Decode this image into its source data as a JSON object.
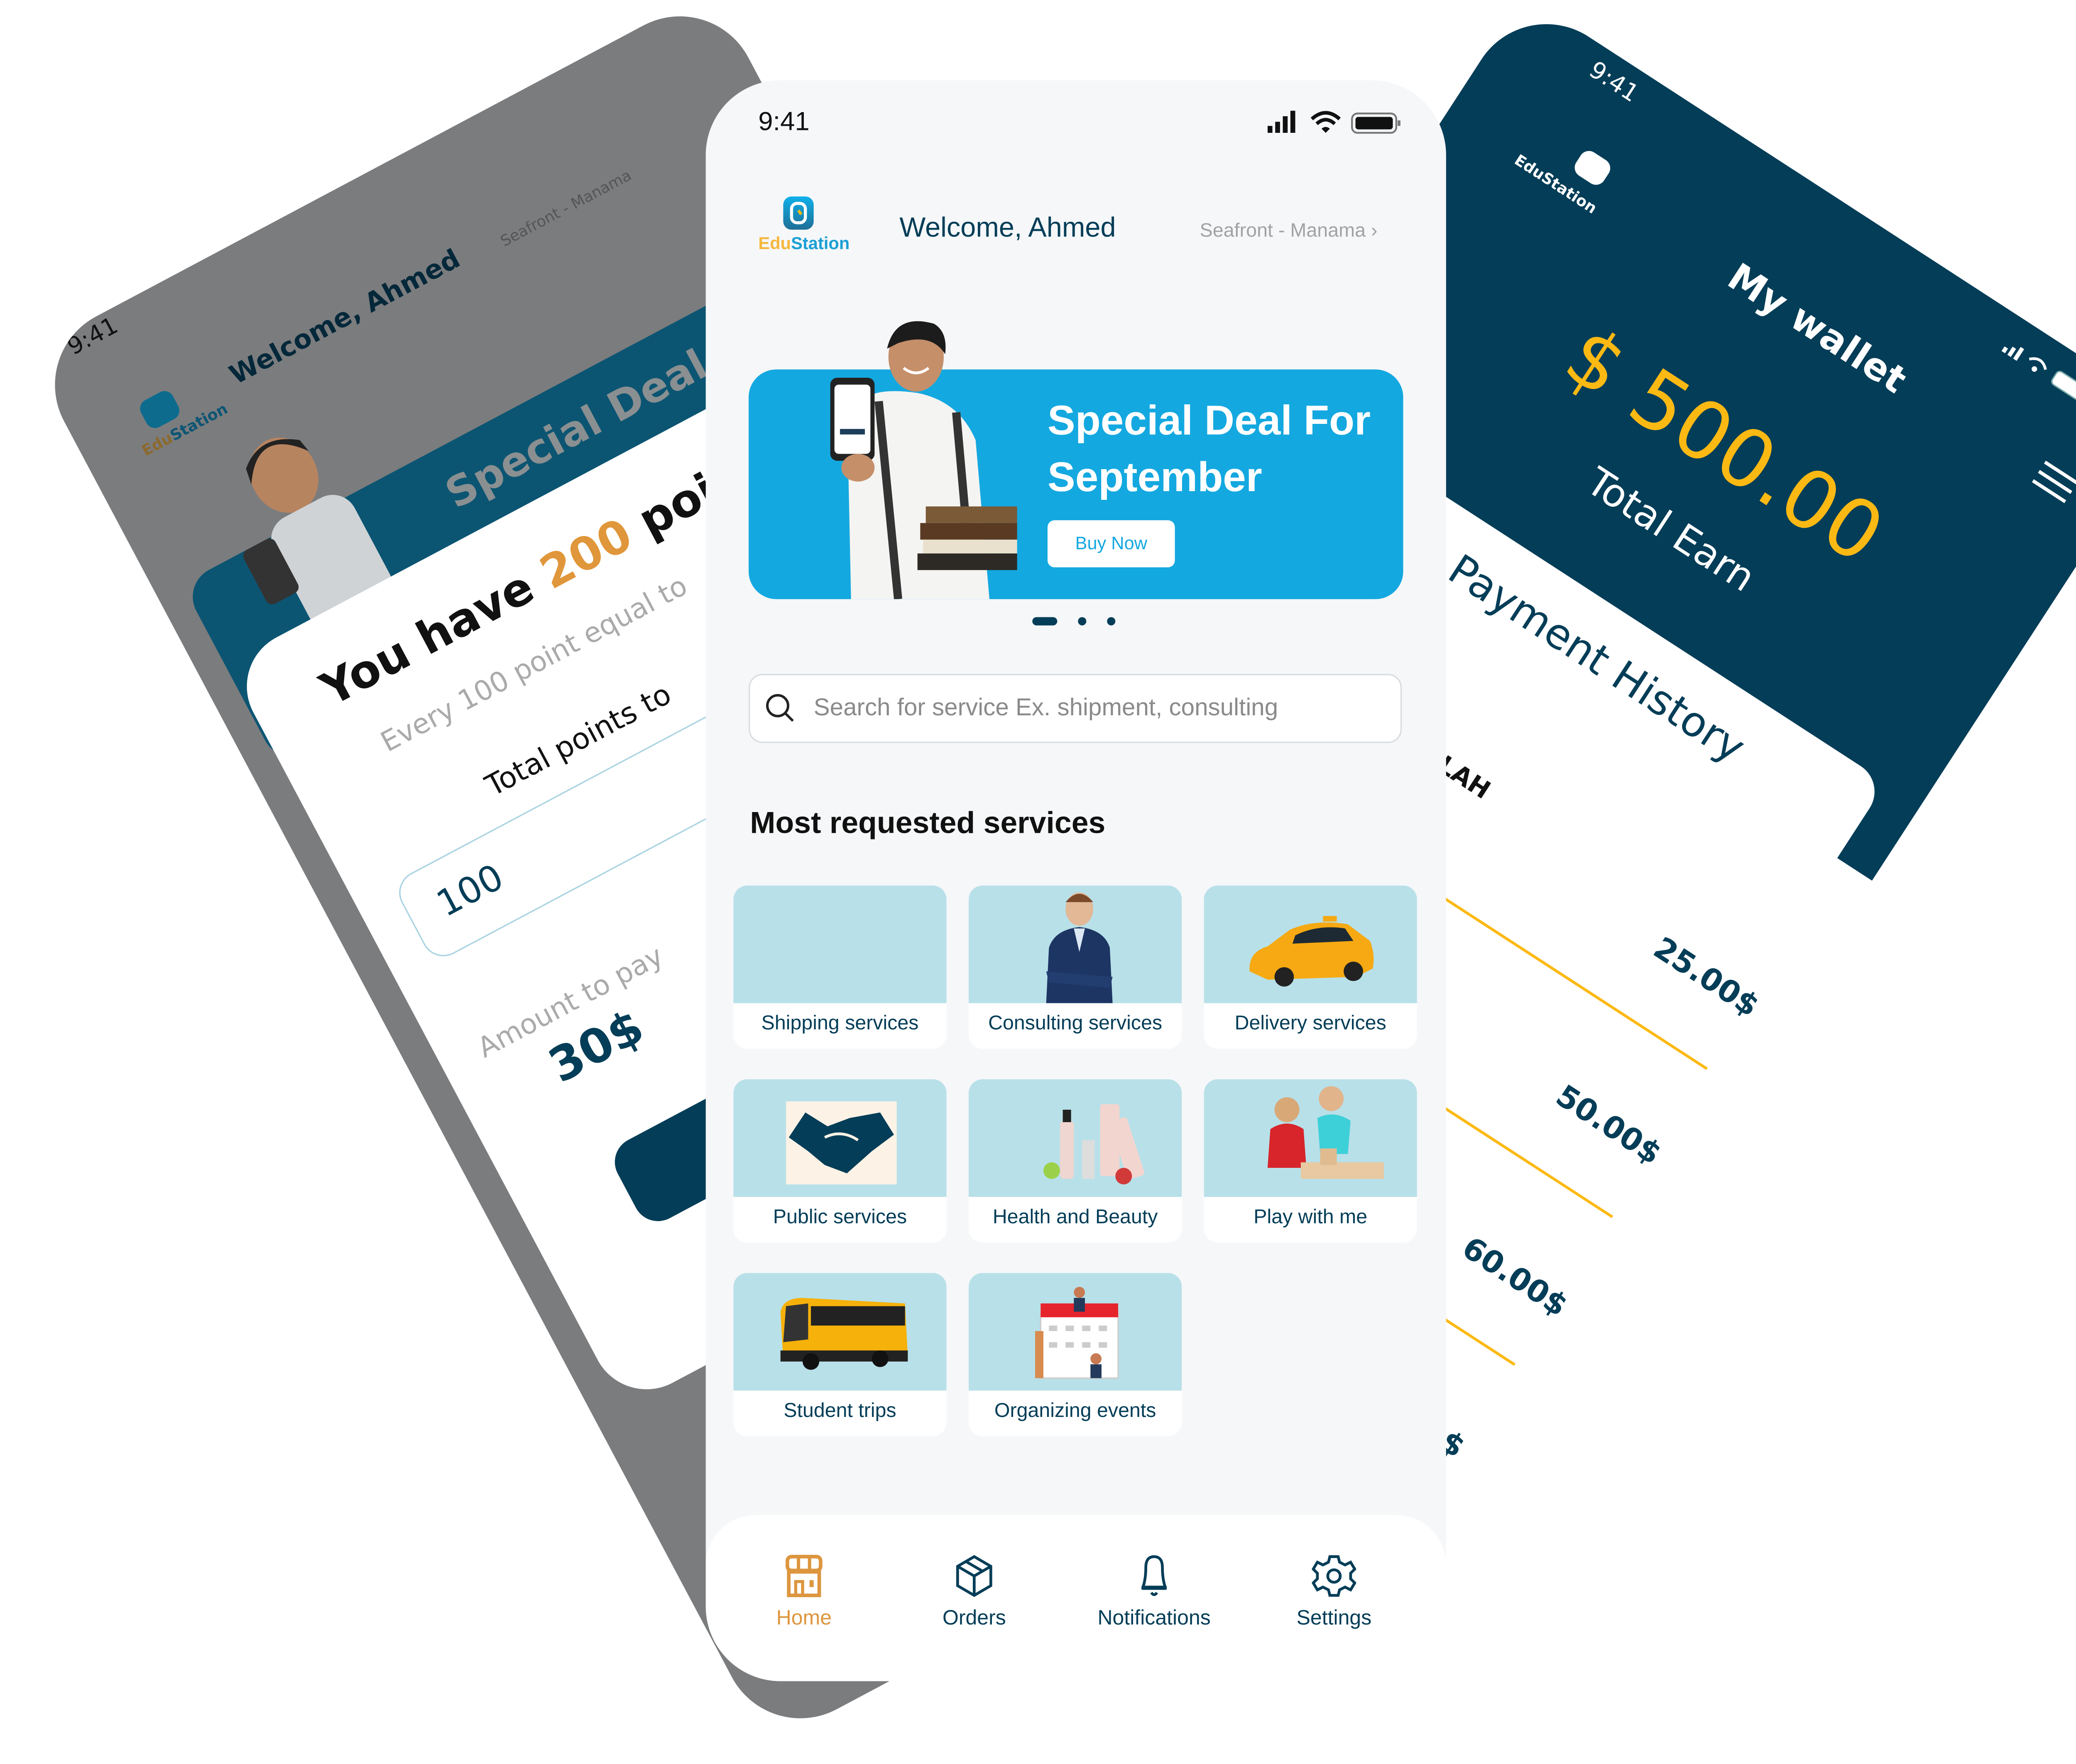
{
  "colors": {
    "primary": "#033d57",
    "accent": "#14a8e0",
    "orange": "#dd963e",
    "gold": "#fdb913",
    "card_bg": "#b8e0e9"
  },
  "left_phone": {
    "status_time": "9:41",
    "logo": {
      "part1": "Edu",
      "part2": "Station"
    },
    "welcome": "Welcome, Ahmed",
    "location": "Seafront - Manama",
    "banner_title": "Special Deal F",
    "points_modal": {
      "heading_prefix": "You have",
      "points": "200",
      "heading_suffix": "poin",
      "subtitle": "Every 100 point equal to",
      "total_label": "Total points to",
      "input_value": "100",
      "amount_label": "Amount to pay",
      "amount_value": "30$"
    }
  },
  "right_phone": {
    "status_time": "9:41",
    "logo": "EduStation",
    "title": "My wallet",
    "balance": "$ 500.00",
    "balance_label": "Total Earn",
    "history_title": "Payment History",
    "first_name": "ALAH",
    "payments": [
      {
        "amount": "25.00$"
      },
      {
        "amount": "50.00$"
      },
      {
        "amount": "60.00$"
      },
      {
        "amount": "$"
      }
    ]
  },
  "center_phone": {
    "status_time": "9:41",
    "logo": {
      "part1": "Edu",
      "part2": "Station"
    },
    "welcome": "Welcome, Ahmed",
    "location": "Seafront - Manama",
    "banner": {
      "title_line1": "Special Deal For",
      "title_line2": "September",
      "button": "Buy Now",
      "active_slide": 1,
      "slide_count": 3
    },
    "search": {
      "placeholder": "Search for service Ex. shipment, consulting"
    },
    "section_title": "Most requested services",
    "services": [
      {
        "label": "Shipping services",
        "icon": "shipping-image"
      },
      {
        "label": "Consulting services",
        "icon": "consultant-image"
      },
      {
        "label": "Delivery services",
        "icon": "taxi-car-image"
      },
      {
        "label": "Public services",
        "icon": "handshake-image"
      },
      {
        "label": "Health and Beauty",
        "icon": "cosmetics-image"
      },
      {
        "label": "Play with me",
        "icon": "kids-playing-image"
      },
      {
        "label": "Student trips",
        "icon": "bus-image"
      },
      {
        "label": "Organizing events",
        "icon": "calendar-image"
      }
    ],
    "nav": [
      {
        "label": "Home",
        "icon": "store-icon",
        "active": true
      },
      {
        "label": "Orders",
        "icon": "box-icon",
        "active": false
      },
      {
        "label": "Notifications",
        "icon": "bell-icon",
        "active": false
      },
      {
        "label": "Settings",
        "icon": "gear-icon",
        "active": false
      }
    ]
  }
}
